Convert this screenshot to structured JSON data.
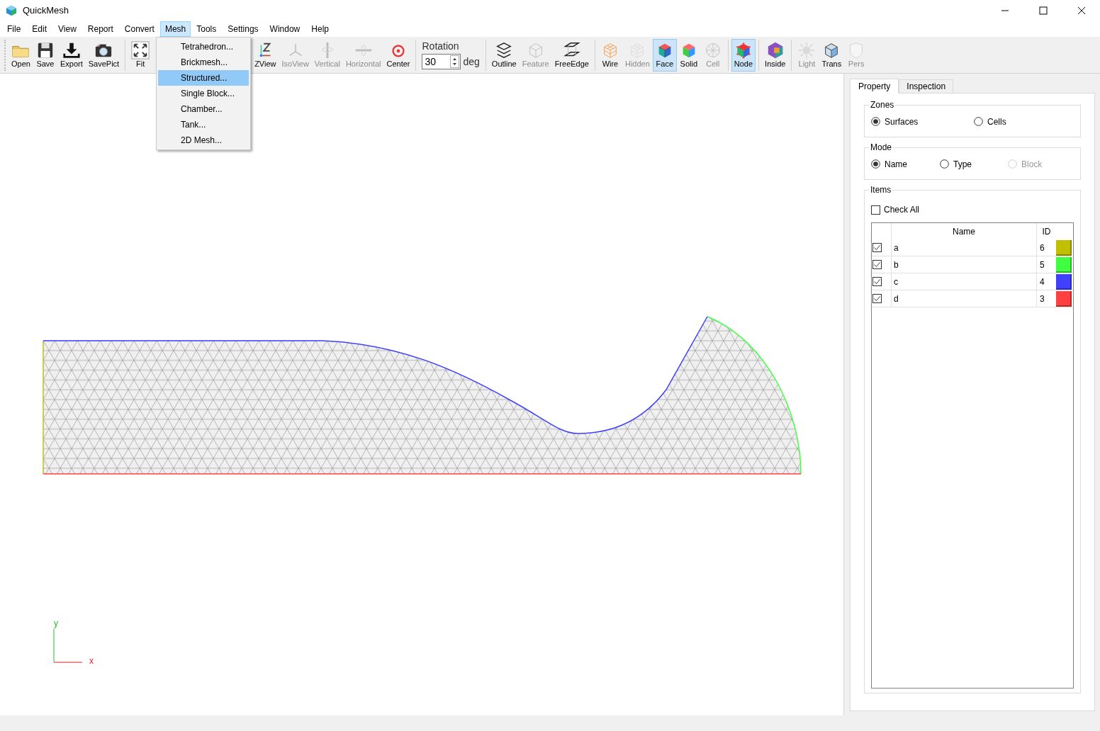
{
  "window": {
    "title": "QuickMesh"
  },
  "menu_bar": [
    {
      "label": "File",
      "selected": false
    },
    {
      "label": "Edit",
      "selected": false
    },
    {
      "label": "View",
      "selected": false
    },
    {
      "label": "Report",
      "selected": false
    },
    {
      "label": "Convert",
      "selected": false
    },
    {
      "label": "Mesh",
      "selected": true
    },
    {
      "label": "Tools",
      "selected": false
    },
    {
      "label": "Settings",
      "selected": false
    },
    {
      "label": "Window",
      "selected": false
    },
    {
      "label": "Help",
      "selected": false
    }
  ],
  "mesh_menu": [
    {
      "label": "Tetrahedron...",
      "selected": false
    },
    {
      "label": "Brickmesh...",
      "selected": false
    },
    {
      "label": "Structured...",
      "selected": true
    },
    {
      "label": "Single Block...",
      "selected": false
    },
    {
      "label": "Chamber...",
      "selected": false
    },
    {
      "label": "Tank...",
      "selected": false
    },
    {
      "label": "2D Mesh...",
      "selected": false
    }
  ],
  "toolbar": [
    {
      "kind": "button",
      "label": "Open",
      "disabled": false,
      "selected": false
    },
    {
      "kind": "button",
      "label": "Save",
      "disabled": false,
      "selected": false
    },
    {
      "kind": "button",
      "label": "Export",
      "disabled": false,
      "selected": false
    },
    {
      "kind": "button",
      "label": "SavePict",
      "disabled": false,
      "selected": false
    },
    {
      "kind": "separator"
    },
    {
      "kind": "button",
      "label": "Fit",
      "disabled": false,
      "selected": false
    },
    {
      "kind": "covered"
    },
    {
      "kind": "button",
      "label": "ZView",
      "disabled": false,
      "selected": false
    },
    {
      "kind": "button",
      "label": "IsoView",
      "disabled": true,
      "selected": false
    },
    {
      "kind": "button",
      "label": "Vertical",
      "disabled": true,
      "selected": false
    },
    {
      "kind": "button",
      "label": "Horizontal",
      "disabled": true,
      "selected": false
    },
    {
      "kind": "button",
      "label": "Center",
      "disabled": false,
      "selected": false
    },
    {
      "kind": "separator"
    },
    {
      "kind": "spin",
      "label": "Rotation",
      "value": "30",
      "unit": "deg"
    },
    {
      "kind": "separator"
    },
    {
      "kind": "button",
      "label": "Outline",
      "disabled": false,
      "selected": false
    },
    {
      "kind": "button",
      "label": "Feature",
      "disabled": true,
      "selected": false
    },
    {
      "kind": "button",
      "label": "FreeEdge",
      "disabled": false,
      "selected": false
    },
    {
      "kind": "separator"
    },
    {
      "kind": "button",
      "label": "Wire",
      "disabled": false,
      "selected": false
    },
    {
      "kind": "button",
      "label": "Hidden",
      "disabled": true,
      "selected": false
    },
    {
      "kind": "button",
      "label": "Face",
      "disabled": false,
      "selected": true
    },
    {
      "kind": "button",
      "label": "Solid",
      "disabled": false,
      "selected": false
    },
    {
      "kind": "button",
      "label": "Cell",
      "disabled": true,
      "selected": false
    },
    {
      "kind": "separator"
    },
    {
      "kind": "button",
      "label": "Node",
      "disabled": false,
      "selected": true
    },
    {
      "kind": "separator"
    },
    {
      "kind": "button",
      "label": "Inside",
      "disabled": false,
      "selected": false
    },
    {
      "kind": "separator"
    },
    {
      "kind": "button",
      "label": "Light",
      "disabled": true,
      "selected": false
    },
    {
      "kind": "button",
      "label": "Trans",
      "disabled": false,
      "selected": false
    },
    {
      "kind": "button",
      "label": "Pers",
      "disabled": true,
      "selected": false
    }
  ],
  "viewport": {
    "axis": {
      "y_label": "y",
      "x_label": "x"
    }
  },
  "right_panel": {
    "tabs": [
      {
        "label": "Property",
        "selected": true
      },
      {
        "label": "Inspection",
        "selected": false
      }
    ],
    "zones": {
      "title": "Zones",
      "options": [
        {
          "label": "Surfaces",
          "selected": true,
          "disabled": false
        },
        {
          "label": "Cells",
          "selected": false,
          "disabled": false
        }
      ]
    },
    "mode": {
      "title": "Mode",
      "options": [
        {
          "label": "Name",
          "selected": true,
          "disabled": false
        },
        {
          "label": "Type",
          "selected": false,
          "disabled": false
        },
        {
          "label": "Block",
          "selected": false,
          "disabled": true
        }
      ]
    },
    "items": {
      "title": "Items",
      "check_all": {
        "label": "Check All",
        "checked": false
      },
      "columns": [
        "Name",
        "ID"
      ],
      "rows": [
        {
          "checked": true,
          "name": "a",
          "id": "6",
          "color": "#c0c000"
        },
        {
          "checked": true,
          "name": "b",
          "id": "5",
          "color": "#40ff40"
        },
        {
          "checked": true,
          "name": "c",
          "id": "4",
          "color": "#4040ff"
        },
        {
          "checked": true,
          "name": "d",
          "id": "3",
          "color": "#ff4040"
        }
      ]
    }
  }
}
